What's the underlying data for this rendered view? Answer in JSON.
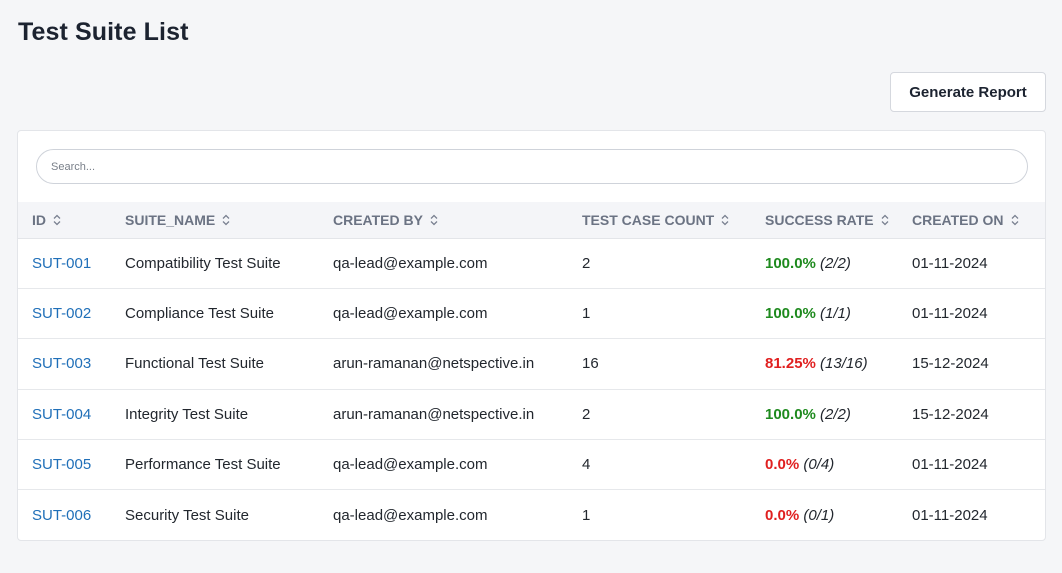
{
  "page": {
    "title": "Test Suite List",
    "generate_report_label": "Generate Report"
  },
  "search": {
    "placeholder": "Search..."
  },
  "colors": {
    "success": "#1e8a1e",
    "failure": "#e01f1f",
    "link": "#1f6fb8"
  },
  "table": {
    "columns": [
      {
        "label": "ID",
        "sort_icon": "sort-icon"
      },
      {
        "label": "SUITE_NAME",
        "sort_icon": "sort-icon"
      },
      {
        "label": "CREATED BY",
        "sort_icon": "sort-icon"
      },
      {
        "label": "TEST CASE COUNT",
        "sort_icon": "sort-icon"
      },
      {
        "label": "SUCCESS RATE",
        "sort_icon": "sort-icon"
      },
      {
        "label": "CREATED ON",
        "sort_icon": "sort-icon"
      }
    ],
    "rows": [
      {
        "id": "SUT-001",
        "suite_name": "Compatibility Test Suite",
        "created_by": "qa-lead@example.com",
        "test_case_count": "2",
        "rate": "100.0%",
        "rate_frac": "(2/2)",
        "rate_status": "good",
        "created_on": "01-11-2024"
      },
      {
        "id": "SUT-002",
        "suite_name": "Compliance Test Suite",
        "created_by": "qa-lead@example.com",
        "test_case_count": "1",
        "rate": "100.0%",
        "rate_frac": "(1/1)",
        "rate_status": "good",
        "created_on": "01-11-2024"
      },
      {
        "id": "SUT-003",
        "suite_name": "Functional Test Suite",
        "created_by": "arun-ramanan@netspective.in",
        "test_case_count": "16",
        "rate": "81.25%",
        "rate_frac": "(13/16)",
        "rate_status": "bad",
        "created_on": "15-12-2024"
      },
      {
        "id": "SUT-004",
        "suite_name": "Integrity Test Suite",
        "created_by": "arun-ramanan@netspective.in",
        "test_case_count": "2",
        "rate": "100.0%",
        "rate_frac": "(2/2)",
        "rate_status": "good",
        "created_on": "15-12-2024"
      },
      {
        "id": "SUT-005",
        "suite_name": "Performance Test Suite",
        "created_by": "qa-lead@example.com",
        "test_case_count": "4",
        "rate": "0.0%",
        "rate_frac": "(0/4)",
        "rate_status": "bad",
        "created_on": "01-11-2024"
      },
      {
        "id": "SUT-006",
        "suite_name": "Security Test Suite",
        "created_by": "qa-lead@example.com",
        "test_case_count": "1",
        "rate": "0.0%",
        "rate_frac": "(0/1)",
        "rate_status": "bad",
        "created_on": "01-11-2024"
      }
    ]
  }
}
